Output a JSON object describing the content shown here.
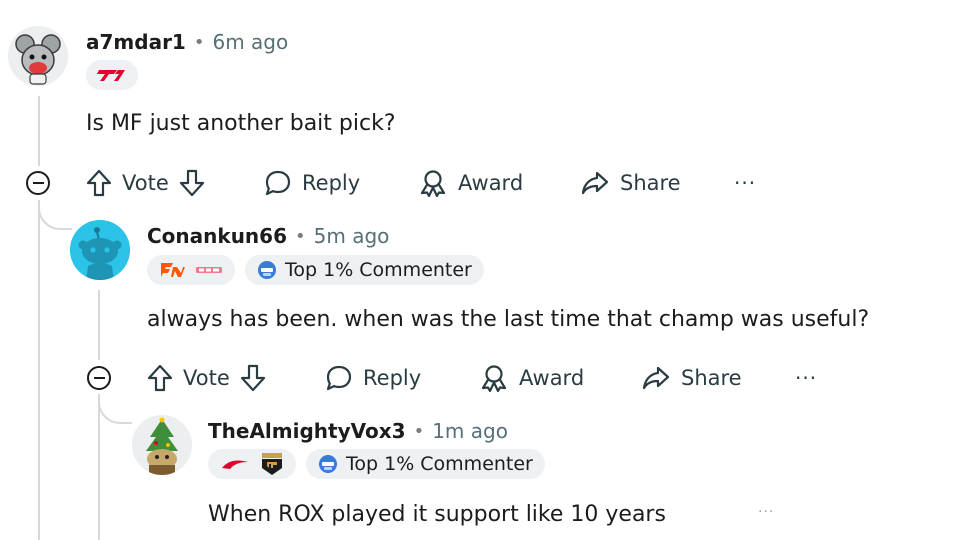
{
  "comments": [
    {
      "username": "a7mdar1",
      "time": "6m ago",
      "body": "Is MF just another bait pick?",
      "actions": {
        "vote": "Vote",
        "reply": "Reply",
        "award": "Award",
        "share": "Share",
        "more": "···"
      }
    },
    {
      "username": "Conankun66",
      "time": "5m ago",
      "badge": "Top 1% Commenter",
      "body": "always has been. when was the last time that champ was useful?",
      "actions": {
        "vote": "Vote",
        "reply": "Reply",
        "award": "Award",
        "share": "Share",
        "more": "···"
      }
    },
    {
      "username": "TheAlmightyVox3",
      "time": "1m ago",
      "badge": "Top 1% Commenter",
      "body": "When ROX played it support like 10 years",
      "more": "···"
    }
  ],
  "separator": "•",
  "icons": [
    "avatar-rat",
    "avatar-snoo-teal",
    "avatar-snoo-tree",
    "t1-logo",
    "fnatic-logo",
    "team-flair-logo",
    "100-thieves-logo",
    "gen-g-logo",
    "trophy-badge-icon",
    "arrow-up-icon",
    "arrow-down-icon",
    "reply-bubble-icon",
    "award-icon",
    "share-icon",
    "collapse-icon",
    "more-icon"
  ],
  "colors": {
    "thread_line": "#d6d9dc",
    "t1_red": "#e2012d",
    "snoo_teal": "#2cc3e8",
    "fnatic_orange": "#ff5900",
    "badge_blue": "#3a7bd5",
    "pill_bg": "#eef1f3"
  }
}
